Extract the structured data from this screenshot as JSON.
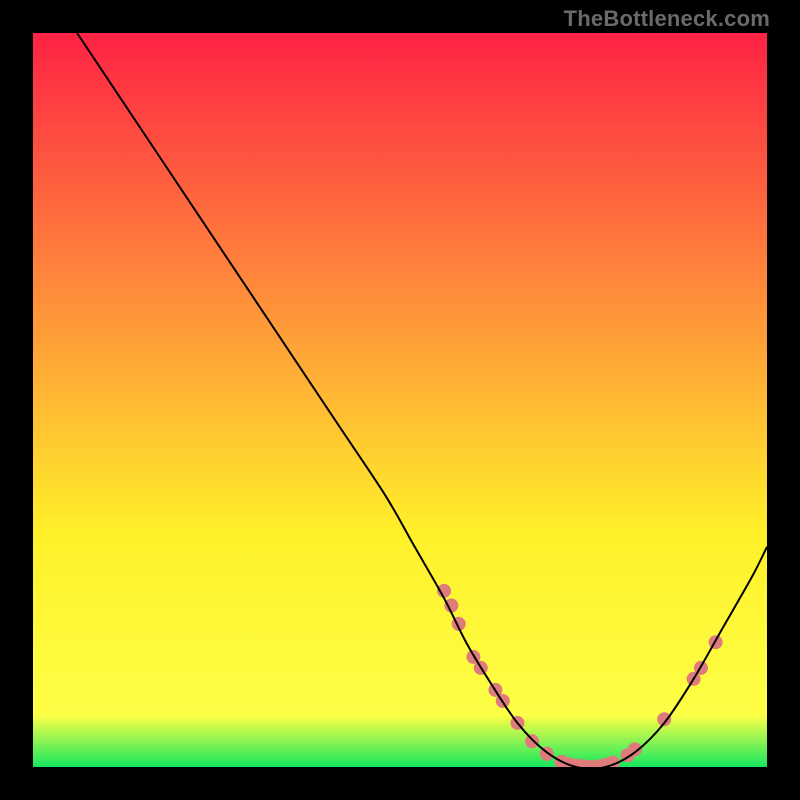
{
  "watermark_text": "TheBottleneck.com",
  "chart_data": {
    "type": "line",
    "title": "",
    "xlabel": "",
    "ylabel": "",
    "xlim": [
      0,
      100
    ],
    "ylim": [
      0,
      100
    ],
    "background_gradient": {
      "top": "#fe2244",
      "mid_upper": "#ff8b3b",
      "mid_lower": "#fff02a",
      "near_bottom": "#fdff46",
      "bottom": "#16e85e"
    },
    "series": [
      {
        "name": "bottleneck-curve",
        "color": "#000000",
        "stroke_width": 2,
        "x": [
          6,
          12,
          18,
          24,
          30,
          36,
          42,
          48,
          52,
          56,
          59,
          62,
          66,
          70,
          74,
          78,
          82,
          86,
          90,
          94,
          98,
          100
        ],
        "values": [
          100,
          91,
          82,
          73,
          64,
          55,
          46,
          37,
          30,
          23,
          17,
          12,
          6,
          2,
          0,
          0,
          2,
          6,
          12,
          19,
          26,
          30
        ]
      }
    ],
    "markers": {
      "name": "highlighted-points",
      "color": "#e07b7b",
      "radius": 7,
      "points": [
        {
          "x": 56,
          "y": 24
        },
        {
          "x": 57,
          "y": 22
        },
        {
          "x": 58,
          "y": 19.5
        },
        {
          "x": 60,
          "y": 15
        },
        {
          "x": 61,
          "y": 13.5
        },
        {
          "x": 63,
          "y": 10.5
        },
        {
          "x": 64,
          "y": 9
        },
        {
          "x": 66,
          "y": 6
        },
        {
          "x": 68,
          "y": 3.5
        },
        {
          "x": 70,
          "y": 1.8
        },
        {
          "x": 72,
          "y": 0.7
        },
        {
          "x": 73,
          "y": 0.4
        },
        {
          "x": 74,
          "y": 0.2
        },
        {
          "x": 75,
          "y": 0.1
        },
        {
          "x": 76,
          "y": 0
        },
        {
          "x": 77,
          "y": 0.1
        },
        {
          "x": 78,
          "y": 0.3
        },
        {
          "x": 79,
          "y": 0.6
        },
        {
          "x": 81,
          "y": 1.6
        },
        {
          "x": 82,
          "y": 2.4
        },
        {
          "x": 86,
          "y": 6.5
        },
        {
          "x": 90,
          "y": 12
        },
        {
          "x": 91,
          "y": 13.5
        },
        {
          "x": 93,
          "y": 17
        }
      ]
    }
  }
}
